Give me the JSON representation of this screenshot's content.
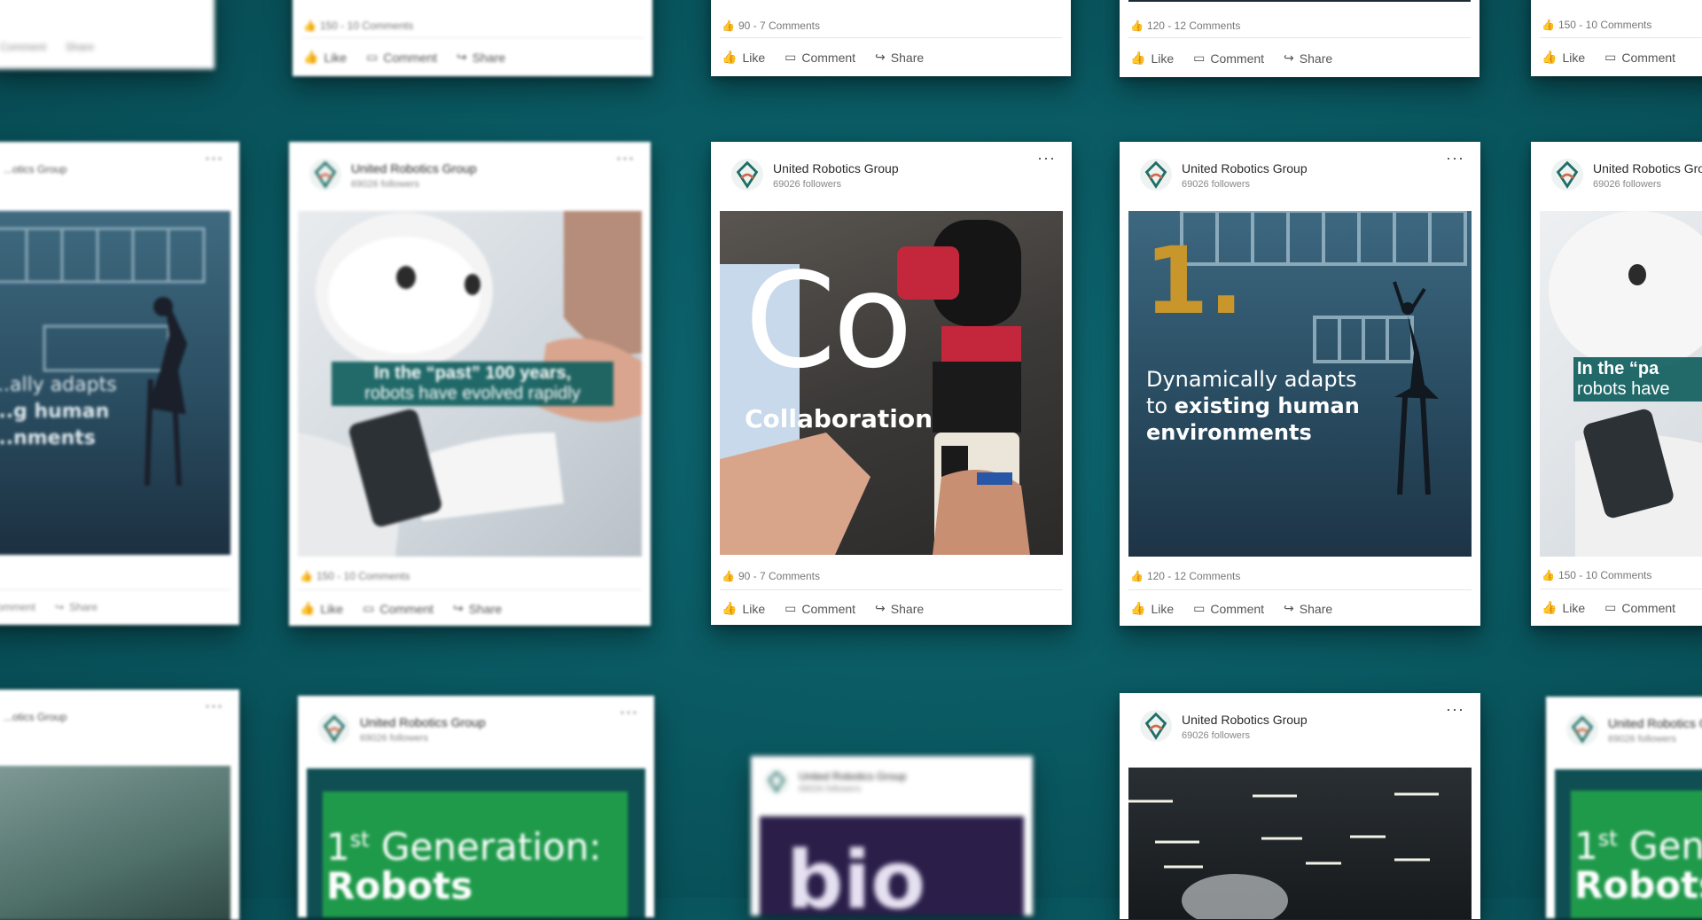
{
  "org": {
    "name": "United Robotics Group",
    "followers": "69026 followers"
  },
  "actions": {
    "like": "Like",
    "comment": "Comment",
    "share": "Share"
  },
  "top_row": {
    "c1": "",
    "c2": "150 - 10 Comments",
    "c3": "90 - 7 Comments",
    "c4": "120 - 12 Comments",
    "c5": "150 - 10 Comments"
  },
  "posts": {
    "left_partial": {
      "caption_line1": "...ally adapts",
      "caption_line2": "...g human",
      "caption_line3": "...nments",
      "stats": "",
      "org_short": "...otics Group"
    },
    "p1": {
      "caption_line1": "In the “past” 100 years,",
      "caption_line2": "robots have evolved rapidly",
      "stats": "150 - 10 Comments"
    },
    "p2": {
      "big": "Co",
      "word": "Collaboration",
      "stats": "90 - 7 Comments"
    },
    "p3": {
      "number": "1.",
      "line1": "Dynamically adapts",
      "line2_pre": "to ",
      "line2_bold": "existing human",
      "line3": "environments",
      "stats": "120 - 12 Comments"
    },
    "p4": {
      "caption_line1": "In the “pa",
      "caption_line2": "robots have",
      "stats": "150 - 10 Comments",
      "org_short": "United Robotics Gro"
    }
  },
  "bottom_row": {
    "b1": {
      "org_short": "...otics Group"
    },
    "b2": {
      "title1": "1",
      "title_sup": "st",
      "title2": " Generation:",
      "title3": "Robots"
    },
    "b3": {
      "text": "bio"
    },
    "b4": {},
    "b5": {
      "title1": "1",
      "title_sup": "st",
      "title2": " Gen",
      "title3": "Robots",
      "org_short": "United Robotics G"
    }
  },
  "colors": {
    "background": "#0b5e67",
    "caption_bg": "#115f5e",
    "gold": "#c9962b",
    "green": "#1f9a4a"
  }
}
